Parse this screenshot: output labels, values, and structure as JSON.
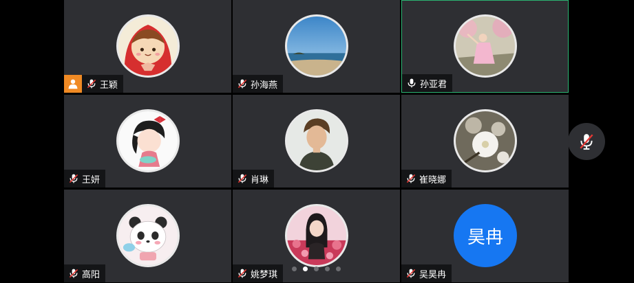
{
  "participants": [
    {
      "name": "王颖",
      "mic": "muted",
      "host": true,
      "avatar": "cartoon-red-hood-girl-icon"
    },
    {
      "name": "孙海燕",
      "mic": "muted",
      "avatar": "beach-sky-photo"
    },
    {
      "name": "孙亚君",
      "mic": "on",
      "active": true,
      "avatar": "pink-dress-blossom-photo"
    },
    {
      "name": "王妍",
      "mic": "muted",
      "avatar": "cartoon-girl-bow-icon"
    },
    {
      "name": "肖琳",
      "mic": "muted",
      "avatar": "young-man-portrait-photo"
    },
    {
      "name": "崔晓娜",
      "mic": "muted",
      "avatar": "white-blossom-photo"
    },
    {
      "name": "高阳",
      "mic": "muted",
      "avatar": "cartoon-panda-bear-icon"
    },
    {
      "name": "姚梦琪",
      "mic": "muted",
      "avatar": "girl-with-flowers-photo"
    },
    {
      "name": "吴昊冉",
      "mic": "muted",
      "avatar_text": "昊冉"
    }
  ],
  "pagination": {
    "pages": 5,
    "current": 2
  },
  "colors": {
    "tile_bg": "#2e2f33",
    "active_border": "#2bb673",
    "mute_red": "#e53935",
    "host_orange": "#f08a24",
    "letter_avatar_blue": "#1677f2"
  },
  "floating_button": {
    "icon": "mic-muted-icon"
  }
}
